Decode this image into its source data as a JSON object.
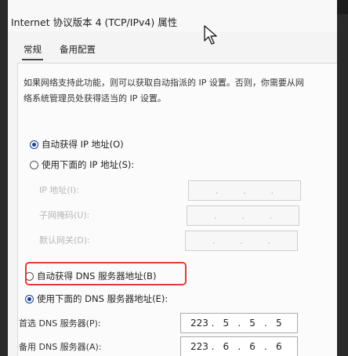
{
  "window": {
    "title": "Internet 协议版本 4 (TCP/IPv4) 属性"
  },
  "tabs": [
    {
      "label": "常规"
    },
    {
      "label": "备用配置"
    }
  ],
  "description": {
    "line1": "如果网络支持此功能，则可以获取自动指派的 IP 设置。否则，你需要从网",
    "line2": "络系统管理员处获得适当的 IP 设置。"
  },
  "ip_section": {
    "auto_option": "自动获得 IP 地址(O)",
    "manual_option": "使用下面的 IP 地址(S):",
    "ip_label": "IP 地址(I):",
    "mask_label": "子网掩码(U):",
    "gateway_label": "默认网关(D):"
  },
  "dns_section": {
    "auto_option": "自动获得 DNS 服务器地址(B)",
    "manual_option": "使用下面的 DNS 服务器地址(E):",
    "preferred_label": "首选 DNS 服务器(P):",
    "preferred_value": [
      "223",
      "5",
      "5",
      "5"
    ],
    "alternate_label": "备用 DNS 服务器(A):",
    "alternate_value": [
      "223",
      "6",
      "6",
      "6"
    ]
  },
  "colors": {
    "highlight": "#e53a3a",
    "radio_selected": "#1a3f8f"
  }
}
